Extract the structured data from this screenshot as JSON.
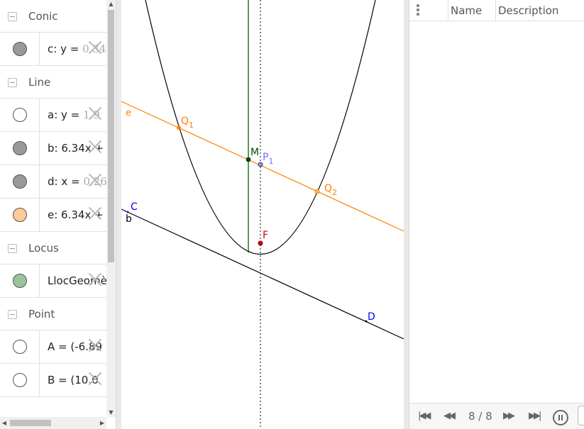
{
  "algebra": {
    "groups": [
      {
        "name": "Conic",
        "items": [
          {
            "prefix": "c: y = ",
            "faded": "0.34",
            "marble": "#999999"
          }
        ]
      },
      {
        "name": "Line",
        "items": [
          {
            "prefix": "a: y = ",
            "faded": "1.9",
            "marble": "#ffffff"
          },
          {
            "prefix": "b: 6.34x + ",
            "faded": "",
            "marble": "#999999"
          },
          {
            "prefix": "d: x = ",
            "faded": "0.26",
            "marble": "#999999"
          },
          {
            "prefix": "e: 6.34x + ",
            "faded": "",
            "marble": "#ffc999"
          }
        ]
      },
      {
        "name": "Locus",
        "items": [
          {
            "prefix": "LlocGeomè",
            "faded": "",
            "marble": "#99c499"
          }
        ]
      },
      {
        "name": "Point",
        "items": [
          {
            "prefix": "A = (-6.89",
            "faded": "",
            "marble": "#ffffff"
          },
          {
            "prefix": "B = (10.0",
            "faded": "",
            "marble": "#ffffff"
          }
        ]
      }
    ]
  },
  "graphics": {
    "labels": {
      "e": "e",
      "Q1": "Q",
      "Q1sub": "1",
      "M": "M",
      "P1": "P",
      "P1sub": "1",
      "Q2": "Q",
      "Q2sub": "2",
      "C": "C",
      "b": "b",
      "F": "F",
      "D": "D"
    },
    "colors": {
      "parabola": "#000000",
      "line_e": "#ff8000",
      "line_d": "#006400",
      "line_b": "#000000",
      "point_blue": "#0000ff",
      "point_F": "#d40000",
      "point_P": "#6f6fff"
    }
  },
  "protocol": {
    "columns": {
      "name": "Name",
      "description": "Description"
    },
    "step": "8 / 8",
    "nav": {
      "first": "first-step",
      "prev": "previous-step",
      "next": "next-step",
      "last": "last-step"
    }
  }
}
